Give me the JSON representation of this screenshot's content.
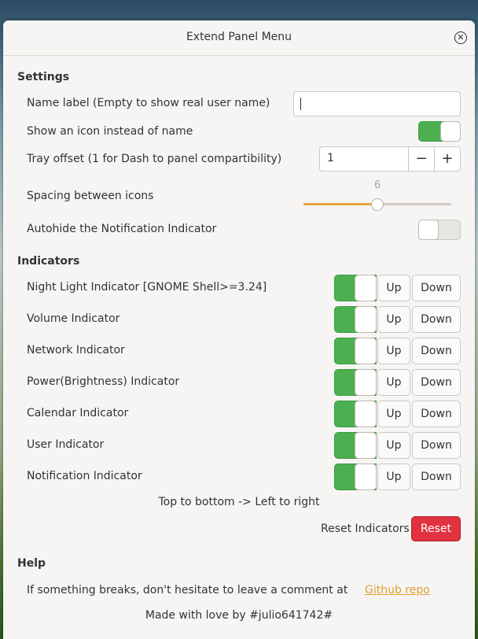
{
  "window": {
    "title": "Extend Panel Menu"
  },
  "settings": {
    "heading": "Settings",
    "name_label": "Name label (Empty to show real user name)",
    "name_value": "",
    "show_icon_label": "Show an icon instead of name",
    "show_icon_on": true,
    "tray_offset_label": "Tray offset (1 for Dash to panel compartibility)",
    "tray_offset_value": "1",
    "minus": "−",
    "plus": "+",
    "spacing_label": "Spacing between icons",
    "spacing_value": "6",
    "spacing_fraction": 0.5,
    "autohide_label": "Autohide the Notification Indicator",
    "autohide_on": false
  },
  "indicators": {
    "heading": "Indicators",
    "up_label": "Up",
    "down_label": "Down",
    "items": [
      {
        "label": "Night Light Indicator [GNOME Shell>=3.24]",
        "on": true
      },
      {
        "label": "Volume Indicator",
        "on": true
      },
      {
        "label": "Network Indicator",
        "on": true
      },
      {
        "label": "Power(Brightness) Indicator",
        "on": true
      },
      {
        "label": "Calendar Indicator",
        "on": true
      },
      {
        "label": "User Indicator",
        "on": true
      },
      {
        "label": "Notification Indicator",
        "on": true
      }
    ],
    "order_hint": "Top to bottom -> Left to right",
    "reset_label": "Reset Indicators",
    "reset_button": "Reset"
  },
  "help": {
    "heading": "Help",
    "text": "If something breaks, don't hesitate to leave a comment at",
    "link": "Github repo",
    "footer": "Made with love by #julio641742#"
  },
  "colors": {
    "accent_green": "#4caf50",
    "slider_orange": "#e8a340",
    "reset_red": "#e03241"
  }
}
